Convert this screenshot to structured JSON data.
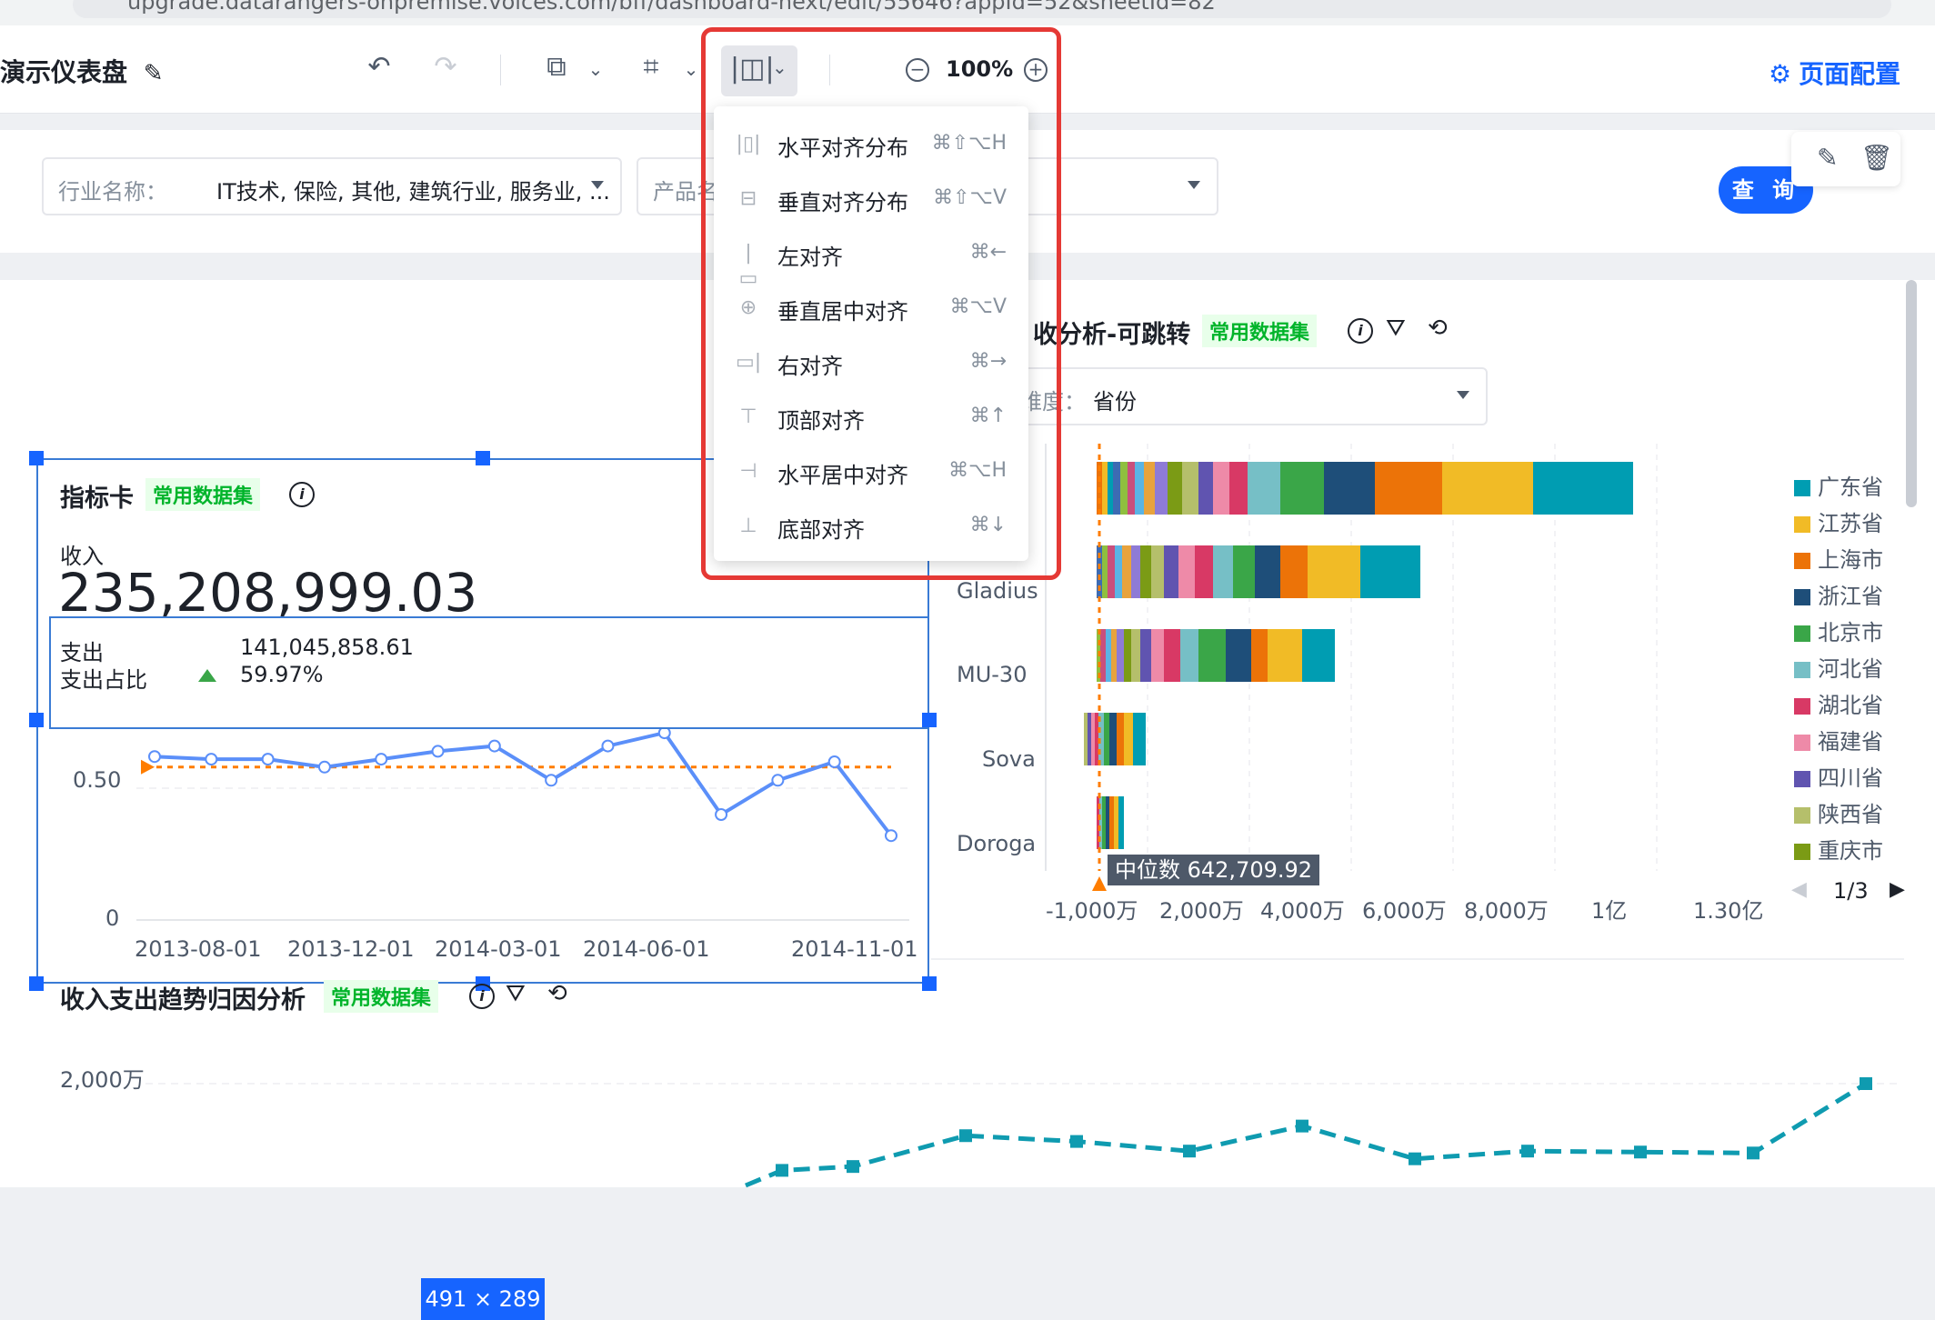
{
  "browser": {
    "url": "upgrade.datarangers-onpremise.volces.com/bff/dashboard-next/edit/55646?appId=52&sheetId=82"
  },
  "toolbar": {
    "title": "演示仪表盘",
    "zoom": "100%",
    "page_config": "页面配置"
  },
  "filters": [
    {
      "label": "行业名称：",
      "value": "IT技术, 保险, 其他, 建筑行业, 服务业, ..."
    },
    {
      "label": "产品名",
      "value": ""
    }
  ],
  "query_button": "查 询",
  "align_menu": {
    "items": [
      {
        "label": "水平对齐分布",
        "shortcut": "⌘⇧⌥H",
        "icon": "distribute-horizontal-icon"
      },
      {
        "label": "垂直对齐分布",
        "shortcut": "⌘⇧⌥V",
        "icon": "distribute-vertical-icon"
      },
      {
        "label": "左对齐",
        "shortcut": "⌘←",
        "icon": "align-left-icon"
      },
      {
        "label": "垂直居中对齐",
        "shortcut": "⌘⌥V",
        "icon": "align-vcenter-icon"
      },
      {
        "label": "右对齐",
        "shortcut": "⌘→",
        "icon": "align-right-icon"
      },
      {
        "label": "顶部对齐",
        "shortcut": "⌘↑",
        "icon": "align-top-icon"
      },
      {
        "label": "水平居中对齐",
        "shortcut": "⌘⌥H",
        "icon": "align-hcenter-icon"
      },
      {
        "label": "底部对齐",
        "shortcut": "⌘↓",
        "icon": "align-bottom-icon"
      }
    ]
  },
  "metric_card": {
    "title": "指标卡",
    "tag": "常用数据集",
    "main_label": "收入",
    "main_value": "235,208,999.03",
    "rows": [
      {
        "label": "支出",
        "value": "141,045,858.61"
      },
      {
        "label": "支出占比",
        "value": "59.97%"
      }
    ],
    "size_badge": "491 × 289"
  },
  "line_chart": {
    "y_ticks": [
      "0.50",
      "0"
    ],
    "x_ticks": [
      "2013-08-01",
      "2013-12-01",
      "2014-03-01",
      "2014-06-01",
      "2014-11-01"
    ],
    "points": [
      0.62,
      0.61,
      0.61,
      0.58,
      0.61,
      0.64,
      0.66,
      0.53,
      0.66,
      0.71,
      0.4,
      0.53,
      0.6,
      0.32
    ],
    "ref_line": 0.58,
    "ref_color": "#ff7d00",
    "line_color": "#5b8ff9"
  },
  "bar_chart": {
    "title": "收分析-可跳转",
    "tag": "常用数据集",
    "dimension_label": "维度：",
    "dimension_value": "省份",
    "categories": [
      "",
      "Gladius",
      "MU-30",
      "Sova",
      "Doroga"
    ],
    "x_ticks": [
      "-1,000万",
      "2,000万",
      "4,000万",
      "6,000万",
      "8,000万",
      "1亿",
      "1.30亿"
    ],
    "median_label": "中位数 642,709.92",
    "legend": [
      {
        "name": "广东省",
        "color": "#009db2"
      },
      {
        "name": "江苏省",
        "color": "#f1bb26"
      },
      {
        "name": "上海市",
        "color": "#ec7308"
      },
      {
        "name": "浙江省",
        "color": "#1e4e79"
      },
      {
        "name": "北京市",
        "color": "#3aa648"
      },
      {
        "name": "河北省",
        "color": "#76bfc6"
      },
      {
        "name": "湖北省",
        "color": "#d83965"
      },
      {
        "name": "福建省",
        "color": "#ee8aa8"
      },
      {
        "name": "四川省",
        "color": "#6054b0"
      },
      {
        "name": "陕西省",
        "color": "#b5bf6b"
      },
      {
        "name": "重庆市",
        "color": "#7b9b15"
      }
    ],
    "pager": "1/3"
  },
  "trend_chart": {
    "title": "收入支出趋势归因分析",
    "tag": "常用数据集",
    "y_tick": "2,000万",
    "line_color": "#0f9bb0"
  }
}
